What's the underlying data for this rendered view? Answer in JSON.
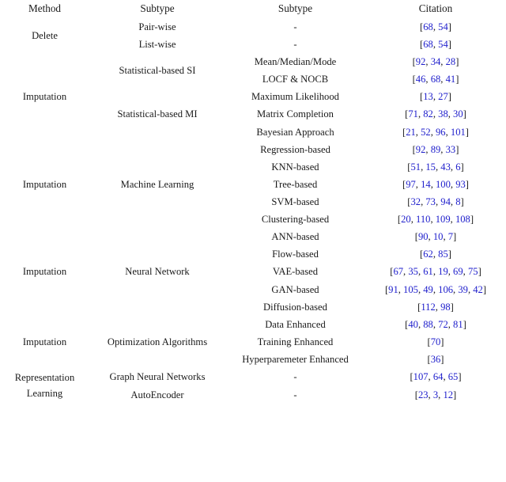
{
  "table": {
    "columns": [
      "Method",
      "Subtype",
      "Subtype",
      "Citation"
    ],
    "link_color": "#2020cc",
    "rule_color": "#4a4a4a",
    "sections": [
      {
        "method": "Delete",
        "groups": [
          {
            "subtype": null,
            "rows": [
              {
                "subtype2": "Pair-wise",
                "detail": "-",
                "citation": "[68, 54]"
              },
              {
                "subtype2": "List-wise",
                "detail": "-",
                "citation": "[68, 54]"
              }
            ]
          }
        ]
      },
      {
        "method": "Imputation",
        "groups": [
          {
            "subtype": "Statistical-based SI",
            "rows": [
              {
                "detail": "Mean/Median/Mode",
                "citation": "[92, 34, 28]"
              },
              {
                "detail": "LOCF & NOCB",
                "citation": "[46, 68, 41]"
              }
            ]
          },
          {
            "subtype": "Statistical-based MI",
            "rows": [
              {
                "detail": "Maximum Likelihood",
                "citation": "[13, 27]"
              },
              {
                "detail": "Matrix Completion",
                "citation": "[71, 82, 38, 30]"
              },
              {
                "detail": "Bayesian Approach",
                "citation": "[21, 52, 96, 101]"
              }
            ]
          }
        ]
      },
      {
        "method": "Imputation",
        "groups": [
          {
            "subtype": "Machine Learning",
            "rows": [
              {
                "detail": "Regression-based",
                "citation": "[92, 89, 33]"
              },
              {
                "detail": "KNN-based",
                "citation": "[51, 15, 43, 6]"
              },
              {
                "detail": "Tree-based",
                "citation": "[97, 14, 100, 93]"
              },
              {
                "detail": "SVM-based",
                "citation": "[32, 73, 94, 8]"
              },
              {
                "detail": "Clustering-based",
                "citation": "[20, 110, 109, 108]"
              }
            ]
          }
        ]
      },
      {
        "method": "Imputation",
        "groups": [
          {
            "subtype": "Neural Network",
            "rows": [
              {
                "detail": "ANN-based",
                "citation": "[90, 10, 7]"
              },
              {
                "detail": "Flow-based",
                "citation": "[62, 85]"
              },
              {
                "detail": "VAE-based",
                "citation": "[67, 35, 61, 19, 69, 75]"
              },
              {
                "detail": "GAN-based",
                "citation": "[91, 105, 49, 106, 39, 42]"
              },
              {
                "detail": "Diffusion-based",
                "citation": "[112, 98]"
              }
            ]
          }
        ]
      },
      {
        "method": "Imputation",
        "groups": [
          {
            "subtype": "Optimization Algorithms",
            "rows": [
              {
                "detail": "Data Enhanced",
                "citation": "[40, 88, 72, 81]"
              },
              {
                "detail": "Training Enhanced",
                "citation": "[70]"
              },
              {
                "detail": "Hyperparemeter Enhanced",
                "citation": "[36]"
              }
            ]
          }
        ]
      },
      {
        "method": "Representation Learning",
        "method_line1": "Representation",
        "method_line2": "Learning",
        "groups": [
          {
            "subtype": null,
            "rows": [
              {
                "subtype2": "Graph Neural Networks",
                "detail": "-",
                "citation": "[107, 64, 65]"
              },
              {
                "subtype2": "AutoEncoder",
                "detail": "-",
                "citation": "[23, 3, 12]"
              }
            ]
          }
        ]
      }
    ]
  }
}
